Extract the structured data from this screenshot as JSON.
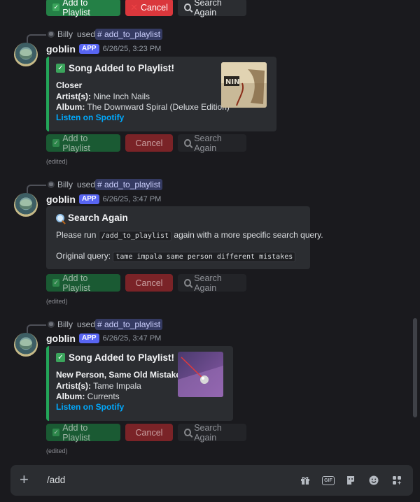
{
  "buttons": {
    "add": "Add to Playlist",
    "cancel": "Cancel",
    "search": "Search Again"
  },
  "edited": "(edited)",
  "messages": [
    {
      "reply_user": "Billy",
      "reply_used": "used",
      "command": "# add_to_playlist",
      "author": "goblin",
      "app_tag": "APP",
      "time": "6/26/25, 3:23 PM",
      "embed_title": "Song Added to Playlist!",
      "song": "Closer",
      "artist_label": "Artist(s):",
      "artist": "Nine Inch Nails",
      "album_label": "Album:",
      "album": "The Downward Spiral (Deluxe Edition)",
      "link": "Listen on Spotify"
    },
    {
      "reply_user": "Billy",
      "reply_used": "used",
      "command": "# add_to_playlist",
      "author": "goblin",
      "app_tag": "APP",
      "time": "6/26/25, 3:47 PM",
      "embed_title": "Search Again",
      "please": "Please run",
      "code": "/add_to_playlist",
      "again": "again with a more specific search query.",
      "orig_label": "Original query:",
      "query": "tame impala same person different mistakes"
    },
    {
      "reply_user": "Billy",
      "reply_used": "used",
      "command": "# add_to_playlist",
      "author": "goblin",
      "app_tag": "APP",
      "time": "6/26/25, 3:47 PM",
      "embed_title": "Song Added to Playlist!",
      "song": "New Person, Same Old Mistakes",
      "artist_label": "Artist(s):",
      "artist": "Tame Impala",
      "album_label": "Album:",
      "album": "Currents",
      "link": "Listen on Spotify"
    }
  ],
  "composer": {
    "text": "/add",
    "icons": [
      "gift-icon",
      "gif-icon",
      "sticker-icon",
      "emoji-icon",
      "apps-icon"
    ],
    "gif_label": "GIF"
  }
}
